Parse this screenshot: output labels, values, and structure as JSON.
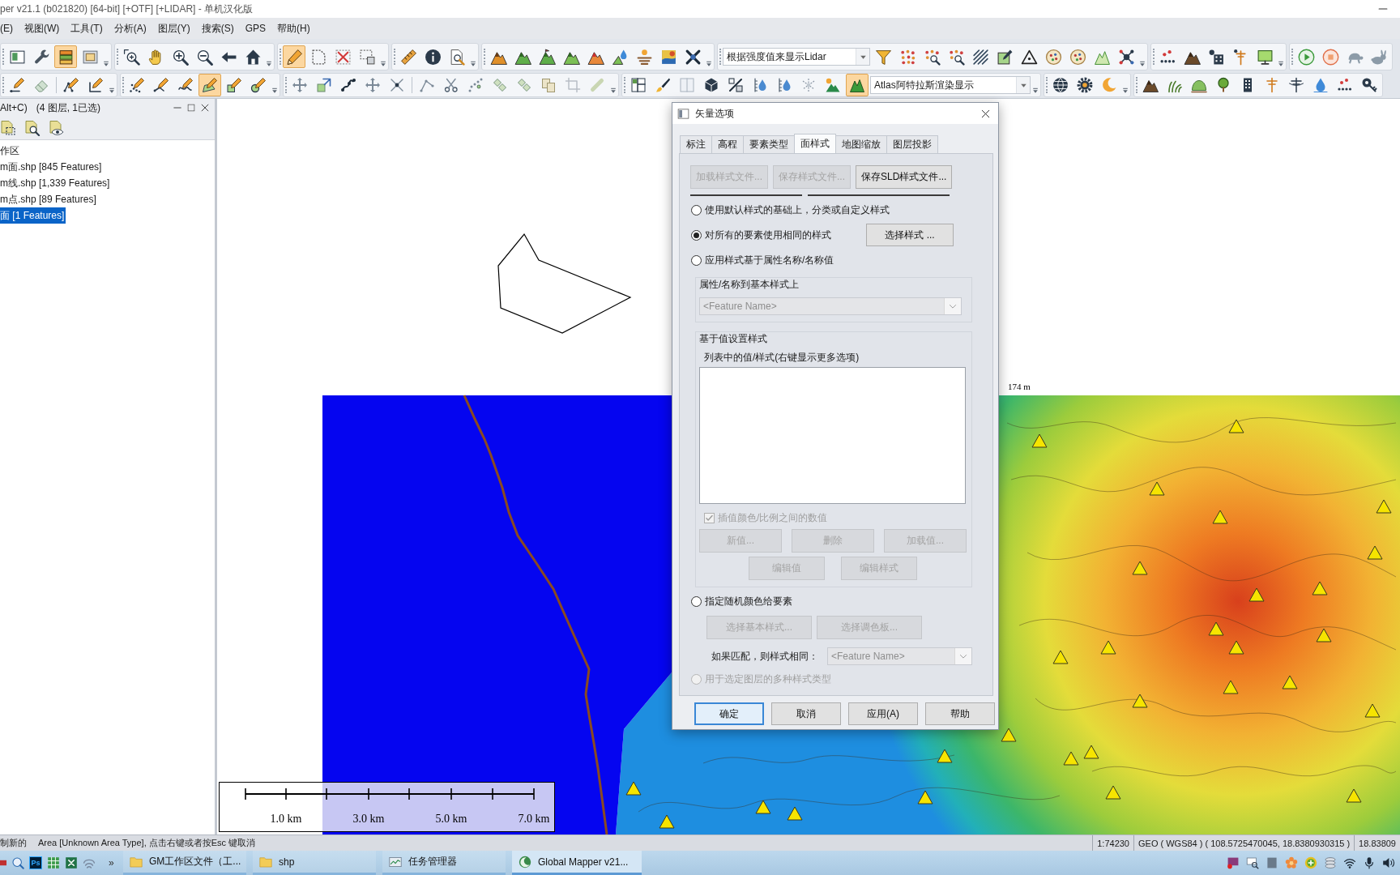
{
  "window": {
    "title": "per v21.1 (b021820) [64-bit] [+OTF] [+LIDAR] - 单机汉化版"
  },
  "menu": [
    "(E)",
    "视图(W)",
    "工具(T)",
    "分析(A)",
    "图层(Y)",
    "搜索(S)",
    "GPS",
    "帮助(H)"
  ],
  "toolbars": [
    [
      {
        "items": [
          {
            "kind": "button",
            "pressed": false
          },
          {
            "kind": "button",
            "pressed": false
          },
          {
            "kind": "button",
            "pressed": true
          },
          {
            "kind": "button",
            "pressed": false
          }
        ]
      },
      {
        "items": [
          {
            "kind": "button",
            "pressed": false
          },
          {
            "kind": "button",
            "pressed": false
          },
          {
            "kind": "button",
            "pressed": false
          },
          {
            "kind": "button",
            "pressed": false
          },
          {
            "kind": "button",
            "pressed": false
          },
          {
            "kind": "button",
            "pressed": false
          }
        ]
      },
      {
        "items": [
          {
            "kind": "button",
            "pressed": true
          },
          {
            "kind": "button",
            "pressed": false
          },
          {
            "kind": "button",
            "pressed": false
          },
          {
            "kind": "button",
            "pressed": false
          }
        ]
      },
      {
        "items": [
          {
            "kind": "button",
            "pressed": false
          },
          {
            "kind": "button",
            "pressed": false
          },
          {
            "kind": "button",
            "pressed": false
          }
        ]
      },
      {
        "items": [
          {
            "kind": "button",
            "pressed": false
          },
          {
            "kind": "button",
            "pressed": false
          },
          {
            "kind": "button",
            "pressed": false
          },
          {
            "kind": "button",
            "pressed": false
          },
          {
            "kind": "button",
            "pressed": false
          },
          {
            "kind": "button",
            "pressed": false
          },
          {
            "kind": "button",
            "pressed": false
          },
          {
            "kind": "button",
            "pressed": false
          },
          {
            "kind": "button",
            "pressed": false
          }
        ]
      },
      {
        "items": [
          {
            "kind": "dropdown",
            "value": "根据强度值来显示Lidar"
          },
          {
            "kind": "button",
            "pressed": false
          },
          {
            "kind": "button",
            "pressed": false
          },
          {
            "kind": "button",
            "pressed": false
          },
          {
            "kind": "button",
            "pressed": false
          },
          {
            "kind": "button",
            "pressed": false
          },
          {
            "kind": "button",
            "pressed": false
          },
          {
            "kind": "button",
            "pressed": false
          },
          {
            "kind": "button",
            "pressed": false
          },
          {
            "kind": "button",
            "pressed": false
          },
          {
            "kind": "button",
            "pressed": false
          },
          {
            "kind": "button",
            "pressed": false
          }
        ]
      },
      {
        "items": [
          {
            "kind": "button",
            "pressed": false
          },
          {
            "kind": "button",
            "pressed": false
          },
          {
            "kind": "button",
            "pressed": false
          },
          {
            "kind": "button",
            "pressed": false
          },
          {
            "kind": "button",
            "pressed": false
          }
        ]
      },
      {
        "items": [
          {
            "kind": "button",
            "pressed": false
          },
          {
            "kind": "button",
            "pressed": false
          },
          {
            "kind": "button",
            "pressed": false
          },
          {
            "kind": "button",
            "pressed": false
          }
        ]
      }
    ],
    [
      {
        "items": [
          {
            "kind": "button",
            "pressed": false
          },
          {
            "kind": "button",
            "pressed": false
          },
          {
            "kind": "separator"
          },
          {
            "kind": "button",
            "pressed": false
          },
          {
            "kind": "button",
            "pressed": false
          }
        ]
      },
      {
        "items": [
          {
            "kind": "button",
            "pressed": false
          },
          {
            "kind": "button",
            "pressed": false
          },
          {
            "kind": "button",
            "pressed": false
          },
          {
            "kind": "button",
            "pressed": true
          },
          {
            "kind": "button",
            "pressed": false
          },
          {
            "kind": "button",
            "pressed": false
          }
        ]
      },
      {
        "items": [
          {
            "kind": "button",
            "pressed": false
          },
          {
            "kind": "button",
            "pressed": false
          },
          {
            "kind": "button",
            "pressed": false
          },
          {
            "kind": "button",
            "pressed": false
          },
          {
            "kind": "button",
            "pressed": false
          },
          {
            "kind": "separator"
          },
          {
            "kind": "button",
            "pressed": false
          },
          {
            "kind": "button",
            "pressed": false
          },
          {
            "kind": "button",
            "pressed": false
          },
          {
            "kind": "button",
            "pressed": false
          },
          {
            "kind": "button",
            "pressed": false
          },
          {
            "kind": "button",
            "pressed": false
          },
          {
            "kind": "button",
            "pressed": false
          },
          {
            "kind": "button",
            "pressed": false
          }
        ]
      },
      {
        "items": [
          {
            "kind": "button",
            "pressed": false
          },
          {
            "kind": "button",
            "pressed": false
          },
          {
            "kind": "button",
            "pressed": false
          },
          {
            "kind": "button",
            "pressed": false
          },
          {
            "kind": "button",
            "pressed": false
          },
          {
            "kind": "button",
            "pressed": false
          },
          {
            "kind": "button",
            "pressed": false
          },
          {
            "kind": "button",
            "pressed": false
          },
          {
            "kind": "button",
            "pressed": false
          },
          {
            "kind": "button",
            "pressed": true
          },
          {
            "kind": "dropdown",
            "value": "Atlas阿特拉斯渲染显示"
          }
        ]
      },
      {
        "items": [
          {
            "kind": "button",
            "pressed": false
          },
          {
            "kind": "button",
            "pressed": false
          },
          {
            "kind": "button",
            "pressed": false
          }
        ]
      },
      {
        "items": [
          {
            "kind": "button",
            "pressed": false
          },
          {
            "kind": "button",
            "pressed": false
          },
          {
            "kind": "button",
            "pressed": false
          },
          {
            "kind": "button",
            "pressed": false
          },
          {
            "kind": "button",
            "pressed": false
          },
          {
            "kind": "button",
            "pressed": false
          },
          {
            "kind": "button",
            "pressed": false
          },
          {
            "kind": "button",
            "pressed": false
          },
          {
            "kind": "button",
            "pressed": false
          },
          {
            "kind": "button",
            "pressed": false
          }
        ]
      }
    ]
  ],
  "control_center": {
    "title": "Alt+C)",
    "summary": "(4 图层, 1已选)",
    "layers": [
      {
        "label": "作区",
        "selected": false
      },
      {
        "label": "m面.shp [845 Features]",
        "selected": false
      },
      {
        "label": "m线.shp [1,339 Features]",
        "selected": false
      },
      {
        "label": "m点.shp [89 Features]",
        "selected": false
      },
      {
        "label": "面 [1 Features]",
        "selected": true
      }
    ]
  },
  "map": {
    "label": "174 m",
    "scale_labels": [
      "1.0 km",
      "3.0 km",
      "5.0 km",
      "7.0 km"
    ]
  },
  "dialog": {
    "title": "矢量选项",
    "tabs": [
      {
        "label": "标注",
        "selected": false
      },
      {
        "label": "高程",
        "selected": false
      },
      {
        "label": "要素类型",
        "selected": false
      },
      {
        "label": "面样式",
        "selected": true
      },
      {
        "label": "地图缩放",
        "selected": false
      },
      {
        "label": "图层投影",
        "selected": false
      }
    ],
    "file_buttons": [
      {
        "label": "加载样式文件...",
        "disabled": true
      },
      {
        "label": "保存样式文件...",
        "disabled": true
      },
      {
        "label": "保存SLD样式文件...",
        "disabled": false
      }
    ],
    "sections": [
      {
        "kind": "radio",
        "label": "使用默认样式的基础上，分类或自定义样式",
        "selected": false,
        "disabled": false
      },
      {
        "kind": "radio",
        "label": "对所有的要素使用相同的样式",
        "selected": true,
        "disabled": false,
        "button": {
          "label": "选择样式 ...",
          "disabled": false
        }
      },
      {
        "kind": "radio",
        "label": "应用样式基于属性名称/名称值",
        "selected": false,
        "disabled": false
      },
      {
        "kind": "attribute_group",
        "title": "属性/名称到基本样式上",
        "dropdown": {
          "value": "<Feature Name>",
          "disabled": true
        }
      },
      {
        "kind": "value_group",
        "title": "基于值设置样式",
        "list_label": "列表中的值/样式(右键显示更多选项)",
        "checkbox": {
          "label": "插值颜色/比例之间的数值",
          "checked": true,
          "disabled": true
        },
        "button_rows": [
          [
            {
              "label": "新值...",
              "disabled": true
            },
            {
              "label": "删除",
              "disabled": true
            },
            {
              "label": "加载值...",
              "disabled": true
            }
          ],
          [
            {
              "label": "编辑值",
              "disabled": true
            },
            {
              "label": "编辑样式",
              "disabled": true
            }
          ]
        ]
      },
      {
        "kind": "radio",
        "label": "指定随机颜色给要素",
        "selected": false,
        "disabled": false
      },
      {
        "kind": "random_group",
        "buttons": [
          {
            "label": "选择基本样式...",
            "disabled": true
          },
          {
            "label": "选择调色板...",
            "disabled": true
          }
        ],
        "match_label": "如果匹配，则样式相同：",
        "dropdown": {
          "value": "<Feature Name>",
          "disabled": true
        }
      },
      {
        "kind": "radio",
        "label": "用于选定图层的多种样式类型",
        "selected": false,
        "disabled": true
      }
    ],
    "footer_buttons": [
      {
        "label": "确定",
        "default": true
      },
      {
        "label": "取消",
        "default": false
      },
      {
        "label": "应用(A)",
        "default": false
      },
      {
        "label": "帮助",
        "default": false
      }
    ]
  },
  "status_bar": {
    "mode": "制新的",
    "hint": "Area [Unknown Area Type], 点击右键或者按Esc 键取消",
    "scale": "1:74230",
    "position": "GEO ( WGS84 ) ( 108.5725470045, 18.8380930315 )",
    "extra": "18.83809"
  },
  "taskbar": {
    "app_badge": "Ps",
    "more": "»",
    "tasks": [
      {
        "label": "GM工作区文件（工...",
        "selected": false
      },
      {
        "label": "shp",
        "selected": false
      },
      {
        "label": "任务管理器",
        "selected": false
      },
      {
        "label": "Global Mapper v21...",
        "selected": true
      }
    ]
  }
}
